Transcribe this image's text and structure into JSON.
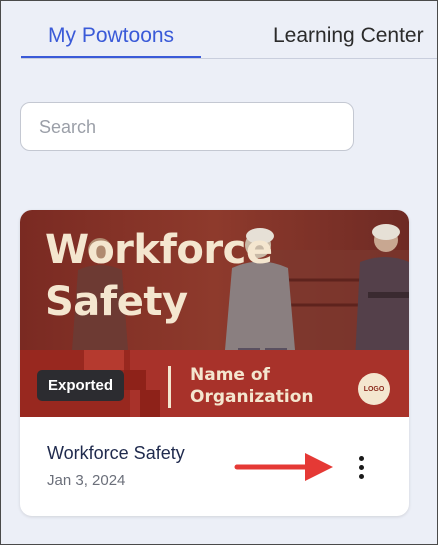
{
  "tabs": [
    {
      "label": "My Powtoons",
      "active": true
    },
    {
      "label": "Learning Center",
      "active": false
    }
  ],
  "search": {
    "placeholder": "Search",
    "value": ""
  },
  "card": {
    "thumbnail": {
      "title_line1": "Workforce",
      "title_line2": "Safety",
      "org_line1": "Name of",
      "org_line2": "Organization",
      "logo": "LOGO"
    },
    "badge": "Exported",
    "name": "Workforce Safety",
    "date": "Jan 3, 2024",
    "menu_icon": "more-vertical-icon"
  },
  "annotation": {
    "icon": "arrow-right-icon",
    "color": "#e53935"
  },
  "colors": {
    "accent": "#3a5ad8",
    "background": "#eceff7",
    "thumbnail_red": "#a8322a",
    "thumbnail_text": "#f4e6cf"
  }
}
